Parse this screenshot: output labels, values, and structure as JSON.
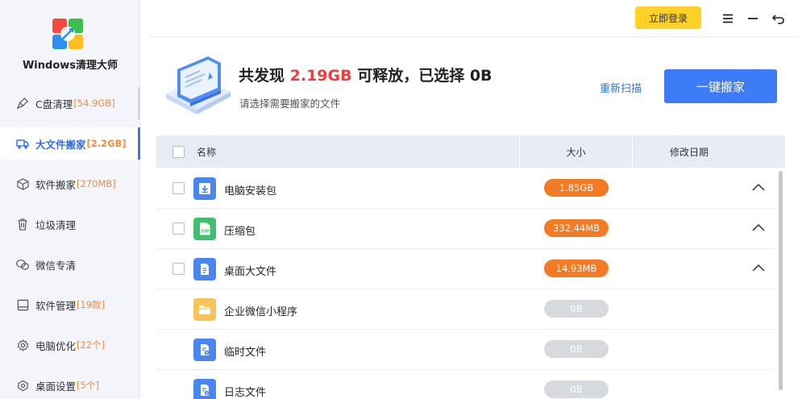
{
  "app": {
    "title": "Windows清理大师"
  },
  "sidebar": {
    "items": [
      {
        "label": "C盘清理",
        "badge": "[54.9GB]",
        "icon": "broom-icon"
      },
      {
        "label": "大文件搬家",
        "badge": "[2.2GB]",
        "icon": "truck-icon"
      },
      {
        "label": "软件搬家",
        "badge": "[270MB]",
        "icon": "cube-icon"
      },
      {
        "label": "垃圾清理",
        "badge": "",
        "icon": "trash-icon"
      },
      {
        "label": "微信专清",
        "badge": "",
        "icon": "wechat-icon"
      },
      {
        "label": "软件管理",
        "badge": "[19款]",
        "icon": "monitor-icon"
      },
      {
        "label": "电脑优化",
        "badge": "[22个]",
        "icon": "gear-icon"
      },
      {
        "label": "桌面设置",
        "badge": "[5个]",
        "icon": "desktop-settings-icon"
      }
    ]
  },
  "topbar": {
    "login_label": "立即登录"
  },
  "summary": {
    "prefix": "共发现 ",
    "found": "2.19GB",
    "middle": " 可释放，已选择 ",
    "selected": "0B",
    "subtitle": "请选择需要搬家的文件",
    "rescan_label": "重新扫描",
    "move_label": "一键搬家"
  },
  "table": {
    "headers": {
      "name": "名称",
      "size": "大小",
      "date": "修改日期"
    },
    "rows": [
      {
        "name": "电脑安装包",
        "size": "1.85GB",
        "icon": "installer-package-icon",
        "level": 0,
        "highlight": true
      },
      {
        "name": "压缩包",
        "size": "332.44MB",
        "icon": "zip-archive-icon",
        "level": 0,
        "highlight": true
      },
      {
        "name": "桌面大文件",
        "size": "14.93MB",
        "icon": "desktop-file-icon",
        "level": 0,
        "highlight": true
      },
      {
        "name": "企业微信小程序",
        "size": "0B",
        "icon": "folder-icon",
        "level": 1,
        "highlight": false
      },
      {
        "name": "临时文件",
        "size": "0B",
        "icon": "temp-file-icon",
        "level": 1,
        "highlight": false
      },
      {
        "name": "日志文件",
        "size": "0B",
        "icon": "log-file-icon",
        "level": 1,
        "highlight": false
      }
    ]
  },
  "colors": {
    "accent": "#3d7cf6",
    "highlight": "#ef3b3b",
    "badge": "#f08a3c",
    "login": "#ffd126",
    "pill": "#f57a24"
  }
}
